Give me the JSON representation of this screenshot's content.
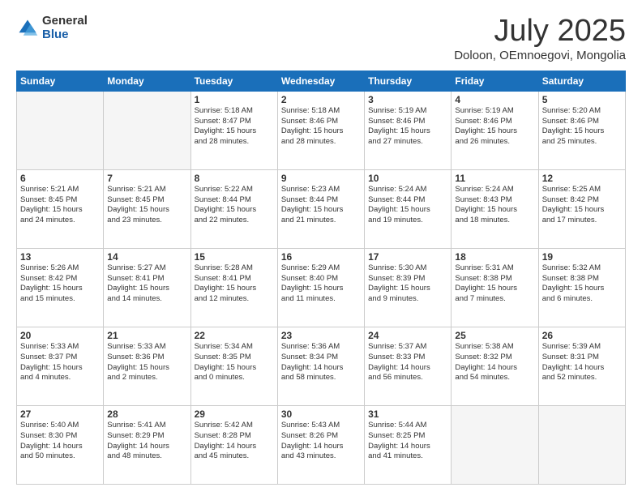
{
  "logo": {
    "general": "General",
    "blue": "Blue"
  },
  "title": "July 2025",
  "subtitle": "Doloon, OEmnoegovi, Mongolia",
  "days_of_week": [
    "Sunday",
    "Monday",
    "Tuesday",
    "Wednesday",
    "Thursday",
    "Friday",
    "Saturday"
  ],
  "weeks": [
    [
      {
        "num": "",
        "info": ""
      },
      {
        "num": "",
        "info": ""
      },
      {
        "num": "1",
        "info": "Sunrise: 5:18 AM\nSunset: 8:47 PM\nDaylight: 15 hours\nand 28 minutes."
      },
      {
        "num": "2",
        "info": "Sunrise: 5:18 AM\nSunset: 8:46 PM\nDaylight: 15 hours\nand 28 minutes."
      },
      {
        "num": "3",
        "info": "Sunrise: 5:19 AM\nSunset: 8:46 PM\nDaylight: 15 hours\nand 27 minutes."
      },
      {
        "num": "4",
        "info": "Sunrise: 5:19 AM\nSunset: 8:46 PM\nDaylight: 15 hours\nand 26 minutes."
      },
      {
        "num": "5",
        "info": "Sunrise: 5:20 AM\nSunset: 8:46 PM\nDaylight: 15 hours\nand 25 minutes."
      }
    ],
    [
      {
        "num": "6",
        "info": "Sunrise: 5:21 AM\nSunset: 8:45 PM\nDaylight: 15 hours\nand 24 minutes."
      },
      {
        "num": "7",
        "info": "Sunrise: 5:21 AM\nSunset: 8:45 PM\nDaylight: 15 hours\nand 23 minutes."
      },
      {
        "num": "8",
        "info": "Sunrise: 5:22 AM\nSunset: 8:44 PM\nDaylight: 15 hours\nand 22 minutes."
      },
      {
        "num": "9",
        "info": "Sunrise: 5:23 AM\nSunset: 8:44 PM\nDaylight: 15 hours\nand 21 minutes."
      },
      {
        "num": "10",
        "info": "Sunrise: 5:24 AM\nSunset: 8:44 PM\nDaylight: 15 hours\nand 19 minutes."
      },
      {
        "num": "11",
        "info": "Sunrise: 5:24 AM\nSunset: 8:43 PM\nDaylight: 15 hours\nand 18 minutes."
      },
      {
        "num": "12",
        "info": "Sunrise: 5:25 AM\nSunset: 8:42 PM\nDaylight: 15 hours\nand 17 minutes."
      }
    ],
    [
      {
        "num": "13",
        "info": "Sunrise: 5:26 AM\nSunset: 8:42 PM\nDaylight: 15 hours\nand 15 minutes."
      },
      {
        "num": "14",
        "info": "Sunrise: 5:27 AM\nSunset: 8:41 PM\nDaylight: 15 hours\nand 14 minutes."
      },
      {
        "num": "15",
        "info": "Sunrise: 5:28 AM\nSunset: 8:41 PM\nDaylight: 15 hours\nand 12 minutes."
      },
      {
        "num": "16",
        "info": "Sunrise: 5:29 AM\nSunset: 8:40 PM\nDaylight: 15 hours\nand 11 minutes."
      },
      {
        "num": "17",
        "info": "Sunrise: 5:30 AM\nSunset: 8:39 PM\nDaylight: 15 hours\nand 9 minutes."
      },
      {
        "num": "18",
        "info": "Sunrise: 5:31 AM\nSunset: 8:38 PM\nDaylight: 15 hours\nand 7 minutes."
      },
      {
        "num": "19",
        "info": "Sunrise: 5:32 AM\nSunset: 8:38 PM\nDaylight: 15 hours\nand 6 minutes."
      }
    ],
    [
      {
        "num": "20",
        "info": "Sunrise: 5:33 AM\nSunset: 8:37 PM\nDaylight: 15 hours\nand 4 minutes."
      },
      {
        "num": "21",
        "info": "Sunrise: 5:33 AM\nSunset: 8:36 PM\nDaylight: 15 hours\nand 2 minutes."
      },
      {
        "num": "22",
        "info": "Sunrise: 5:34 AM\nSunset: 8:35 PM\nDaylight: 15 hours\nand 0 minutes."
      },
      {
        "num": "23",
        "info": "Sunrise: 5:36 AM\nSunset: 8:34 PM\nDaylight: 14 hours\nand 58 minutes."
      },
      {
        "num": "24",
        "info": "Sunrise: 5:37 AM\nSunset: 8:33 PM\nDaylight: 14 hours\nand 56 minutes."
      },
      {
        "num": "25",
        "info": "Sunrise: 5:38 AM\nSunset: 8:32 PM\nDaylight: 14 hours\nand 54 minutes."
      },
      {
        "num": "26",
        "info": "Sunrise: 5:39 AM\nSunset: 8:31 PM\nDaylight: 14 hours\nand 52 minutes."
      }
    ],
    [
      {
        "num": "27",
        "info": "Sunrise: 5:40 AM\nSunset: 8:30 PM\nDaylight: 14 hours\nand 50 minutes."
      },
      {
        "num": "28",
        "info": "Sunrise: 5:41 AM\nSunset: 8:29 PM\nDaylight: 14 hours\nand 48 minutes."
      },
      {
        "num": "29",
        "info": "Sunrise: 5:42 AM\nSunset: 8:28 PM\nDaylight: 14 hours\nand 45 minutes."
      },
      {
        "num": "30",
        "info": "Sunrise: 5:43 AM\nSunset: 8:26 PM\nDaylight: 14 hours\nand 43 minutes."
      },
      {
        "num": "31",
        "info": "Sunrise: 5:44 AM\nSunset: 8:25 PM\nDaylight: 14 hours\nand 41 minutes."
      },
      {
        "num": "",
        "info": ""
      },
      {
        "num": "",
        "info": ""
      }
    ]
  ]
}
